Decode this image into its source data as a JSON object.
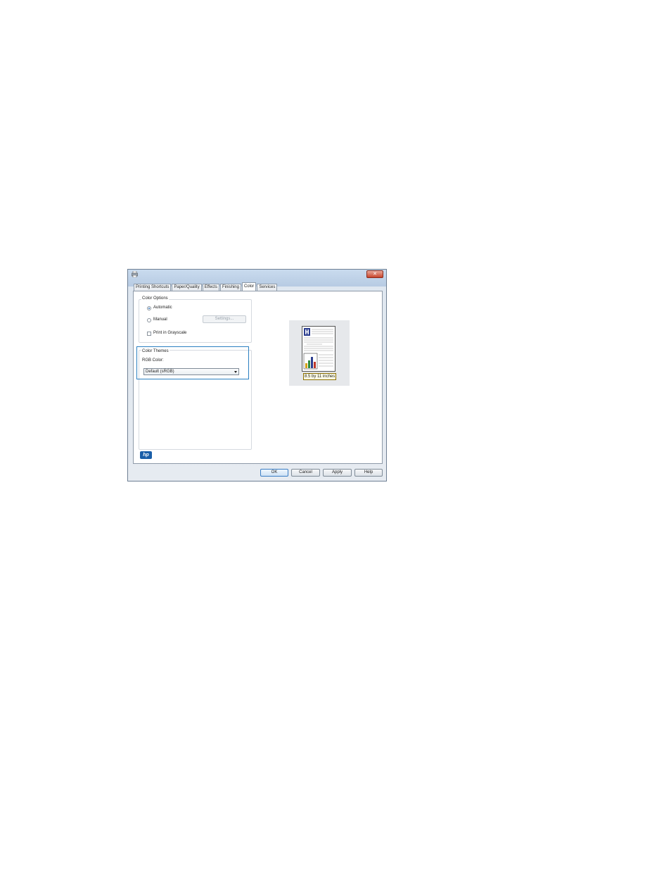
{
  "tabs": [
    "Printing Shortcuts",
    "Paper/Quality",
    "Effects",
    "Finishing",
    "Color",
    "Services"
  ],
  "active_tab": "Color",
  "color_options": {
    "group_label": "Color Options",
    "automatic_label": "Automatic",
    "manual_label": "Manual",
    "settings_button": "Settings...",
    "grayscale_label": "Print in Grayscale"
  },
  "color_themes": {
    "group_label": "Color Themes",
    "rgb_label": "RGB Color:",
    "rgb_value": "Default (sRGB)"
  },
  "preview": {
    "paper_size": "8.5 by 11 inches"
  },
  "brand_logo_text": "hp",
  "buttons": {
    "ok": "OK",
    "cancel": "Cancel",
    "apply": "Apply",
    "help": "Help"
  },
  "colors": {
    "highlight": "#2a7fc1",
    "close": "#c8452d",
    "hp_blue": "#1a5ea8"
  }
}
